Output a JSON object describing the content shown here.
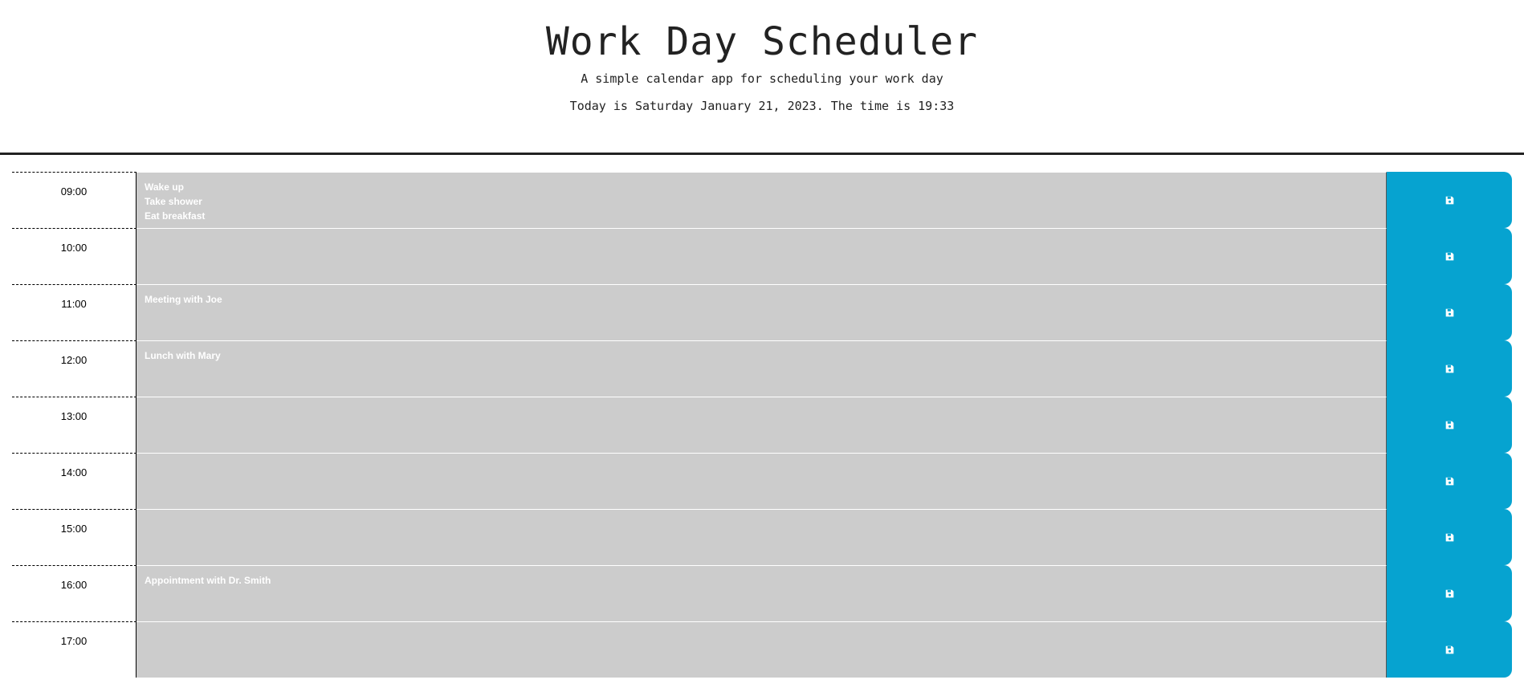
{
  "header": {
    "title": "Work Day Scheduler",
    "subtitle": "A simple calendar app for scheduling your work day",
    "today": "Today is Saturday January 21, 2023. The time is 19:33"
  },
  "colors": {
    "past_row": "#cccccc",
    "save_button": "#06a3d0",
    "header_rule": "#222222"
  },
  "save_icon": "floppy-disk-icon",
  "rows": [
    {
      "hour": "09:00",
      "text": "Wake up\nTake shower\nEat breakfast"
    },
    {
      "hour": "10:00",
      "text": ""
    },
    {
      "hour": "11:00",
      "text": "Meeting with Joe"
    },
    {
      "hour": "12:00",
      "text": "Lunch with Mary"
    },
    {
      "hour": "13:00",
      "text": ""
    },
    {
      "hour": "14:00",
      "text": ""
    },
    {
      "hour": "15:00",
      "text": ""
    },
    {
      "hour": "16:00",
      "text": "Appointment with Dr. Smith"
    },
    {
      "hour": "17:00",
      "text": ""
    }
  ]
}
